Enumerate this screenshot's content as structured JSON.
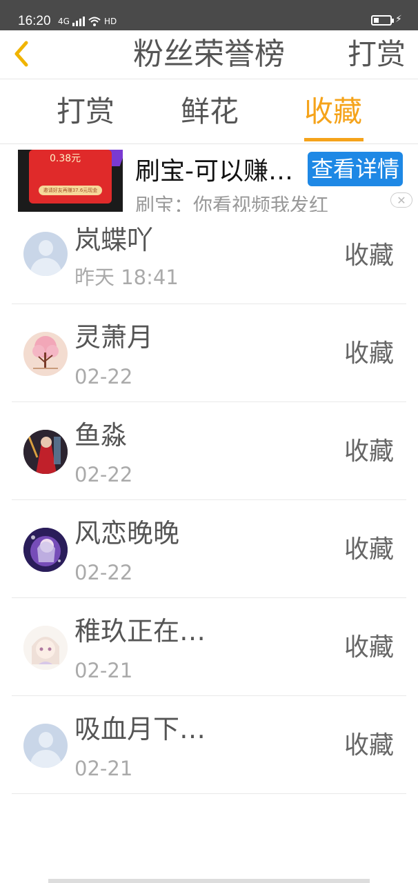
{
  "status_bar": {
    "time": "16:20",
    "net": "4G",
    "hd": "HD",
    "battery_level": 0.3
  },
  "nav": {
    "title": "粉丝荣誉榜",
    "right_label": "打赏"
  },
  "tabs": [
    {
      "label": "打赏"
    },
    {
      "label": "鲜花"
    },
    {
      "label": "收藏"
    }
  ],
  "active_tab": "收藏",
  "ad": {
    "title": "刷宝-可以赚…",
    "button": "查看详情",
    "subtitle": "刷宝：你看视频我发红",
    "close": "✕",
    "image_amount": "0.38元",
    "image_pill": "邀请好友再赚37.6元现金"
  },
  "list": [
    {
      "name": "岚蝶吖",
      "time": "昨天 18:41",
      "action": "收藏",
      "avatar": "default"
    },
    {
      "name": "灵萧月",
      "time": "02-22",
      "action": "收藏",
      "avatar": "tree"
    },
    {
      "name": "鱼淼",
      "time": "02-22",
      "action": "收藏",
      "avatar": "red"
    },
    {
      "name": "风恋晚晚",
      "time": "02-22",
      "action": "收藏",
      "avatar": "purple"
    },
    {
      "name": "稚玖正在…",
      "time": "02-21",
      "action": "收藏",
      "avatar": "anime"
    },
    {
      "name": "吸血月下…",
      "time": "02-21",
      "action": "收藏",
      "avatar": "default"
    }
  ],
  "colors": {
    "accent": "#f5a31a",
    "ad_button": "#1e88e5",
    "status_bar": "#4a4a4a"
  }
}
